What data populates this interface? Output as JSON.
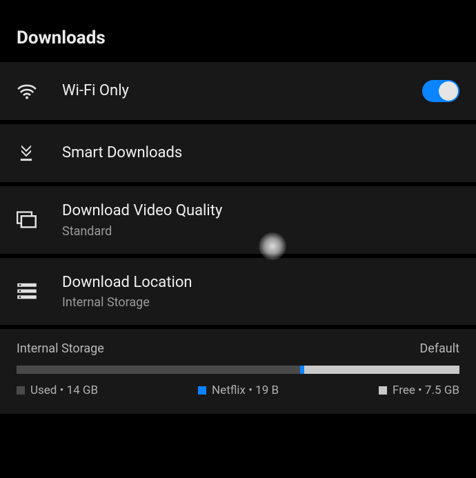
{
  "header": {
    "title": "Downloads"
  },
  "rows": {
    "wifi": {
      "title": "Wi-Fi Only",
      "toggle_on": true
    },
    "smart": {
      "title": "Smart Downloads"
    },
    "quality": {
      "title": "Download Video Quality",
      "subtitle": "Standard"
    },
    "location": {
      "title": "Download Location",
      "subtitle": "Internal Storage"
    }
  },
  "storage": {
    "label": "Internal Storage",
    "tag": "Default",
    "bar": {
      "used_pct": 64,
      "netflix_pct": 1,
      "free_pct": 35
    },
    "legend": {
      "used": "Used • 14 GB",
      "netflix": "Netflix • 19 B",
      "free": "Free • 7.5 GB"
    }
  }
}
